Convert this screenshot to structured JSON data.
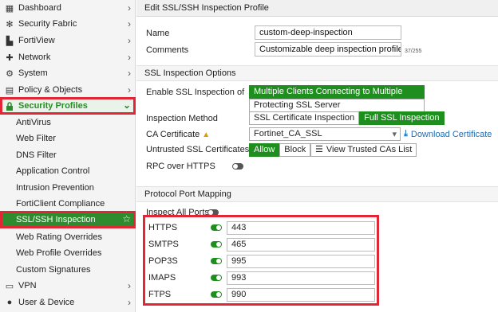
{
  "sidebar": {
    "items": [
      {
        "label": "Dashboard",
        "icon": "dashboard-icon",
        "glyph": "▦"
      },
      {
        "label": "Security Fabric",
        "icon": "security-fabric-icon",
        "glyph": "✻"
      },
      {
        "label": "FortiView",
        "icon": "fortiview-icon",
        "glyph": "▙"
      },
      {
        "label": "Network",
        "icon": "network-icon",
        "glyph": "✚"
      },
      {
        "label": "System",
        "icon": "system-icon",
        "glyph": "⚙"
      },
      {
        "label": "Policy & Objects",
        "icon": "policy-icon",
        "glyph": "▤"
      },
      {
        "label": "Security Profiles",
        "icon": "lock-icon",
        "glyph": "🔒"
      }
    ],
    "sub_items": [
      "AntiVirus",
      "Web Filter",
      "DNS Filter",
      "Application Control",
      "Intrusion Prevention",
      "FortiClient Compliance",
      "SSL/SSH Inspection",
      "Web Rating Overrides",
      "Web Profile Overrides",
      "Custom Signatures"
    ],
    "bottom_items": [
      {
        "label": "VPN",
        "icon": "vpn-icon",
        "glyph": "▭"
      },
      {
        "label": "User & Device",
        "icon": "user-icon",
        "glyph": "●"
      }
    ]
  },
  "page": {
    "title": "Edit SSL/SSH Inspection Profile"
  },
  "form": {
    "name_label": "Name",
    "name_value": "custom-deep-inspection",
    "comments_label": "Comments",
    "comments_value": "Customizable deep inspection profile.",
    "comments_count": "37/255"
  },
  "ssl_options": {
    "header": "SSL Inspection Options",
    "enable_label": "Enable SSL Inspection of",
    "enable_opt1": "Multiple Clients Connecting to Multiple Servers",
    "enable_opt2": "Protecting SSL Server",
    "method_label": "Inspection Method",
    "method_opt1": "SSL Certificate Inspection",
    "method_opt2": "Full SSL Inspection",
    "ca_label": "CA Certificate",
    "ca_value": "Fortinet_CA_SSL",
    "download_label": "Download Certificate",
    "untrusted_label": "Untrusted SSL Certificates",
    "allow_label": "Allow",
    "block_label": "Block",
    "view_label": "View Trusted CAs List",
    "rpc_label": "RPC over HTTPS"
  },
  "port_mapping": {
    "header": "Protocol Port Mapping",
    "inspect_all_label": "Inspect All Ports",
    "ports": [
      {
        "name": "HTTPS",
        "value": "443"
      },
      {
        "name": "SMTPS",
        "value": "465"
      },
      {
        "name": "POP3S",
        "value": "995"
      },
      {
        "name": "IMAPS",
        "value": "993"
      },
      {
        "name": "FTPS",
        "value": "990"
      }
    ]
  },
  "colors": {
    "accent": "#1e8f1e",
    "highlight": "#e32636",
    "link": "#1f6fb5",
    "warning": "#e09b00"
  }
}
